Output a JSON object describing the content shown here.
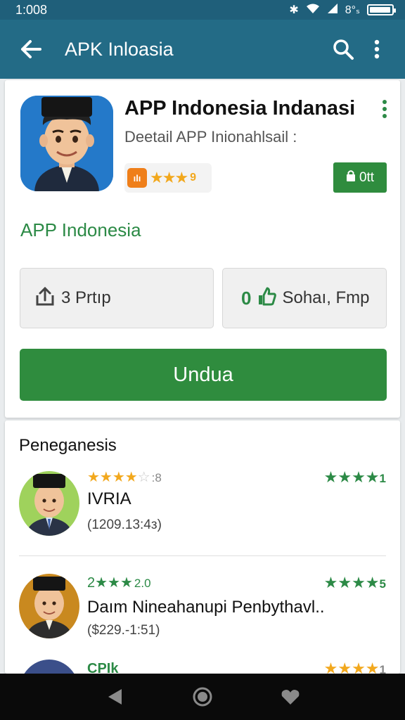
{
  "status_bar": {
    "time": "1:008",
    "icons": [
      "bluetooth-icon",
      "wifi-icon",
      "signal-icon",
      "battery-icon"
    ],
    "misc": "8°ₛ",
    "battery_level": 0.95
  },
  "app_bar": {
    "title": "APK Inloasia",
    "back_icon": "back-arrow-icon",
    "search_icon": "search-icon",
    "menu_icon": "more-vert-icon"
  },
  "app": {
    "name": "APP Indonesia Indanasi",
    "subtitle": "Deetail APP Inionahlsail :",
    "rating_chip_badge": "ılı",
    "rating_chip_stars": "★★★",
    "rating_chip_value": "9",
    "install_chip_label": "0tt",
    "developer": "APP Indonesia",
    "info_left": {
      "label": "3 Prtıp",
      "icon": "upload-icon"
    },
    "info_right": {
      "number": "0",
      "label": "Sohaı, Fmp",
      "icon": "thumbs-up-icon"
    },
    "install_button": "Undua"
  },
  "reviews": {
    "title": "Peneganesis",
    "items": [
      {
        "stars": "★★★★",
        "empty_stars": "☆",
        "star_value": ":8",
        "rating_right_stars": "★★★★",
        "rating_right_value": "1",
        "name": "IVRIA",
        "date": "(1209.13:4з)"
      },
      {
        "stars": "2★★★",
        "empty_stars": "",
        "star_value": "2.0",
        "rating_right_stars": "★★★★",
        "rating_right_value": "5",
        "name": "Daım Nineahanupi Penbythavl..",
        "date": "($229.-1:51)"
      },
      {
        "stars": "",
        "empty_stars": "",
        "star_value": "",
        "rating_right_stars": "★★★★",
        "rating_right_value": "1",
        "name": "CPIk",
        "date": ""
      }
    ]
  },
  "colors": {
    "app_bar": "#236b86",
    "status_bar": "#1f5f7a",
    "accent_green": "#2f8c3e",
    "star": "#f2a81d",
    "nav_bar": "#0a0a0a"
  }
}
